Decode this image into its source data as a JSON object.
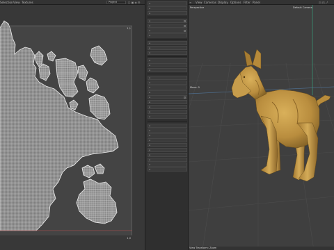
{
  "menubar": {
    "uv_menus": [
      "Selection",
      "View",
      "Textures"
    ],
    "uv_dropdown": "Project",
    "vp_menus": [
      "View",
      "Cameras",
      "Display",
      "Options",
      "Filter",
      "Panel"
    ]
  },
  "uv_editor": {
    "corner_tl": "1,1",
    "corner_br": "1,0"
  },
  "tools": [
    "",
    "",
    "",
    "",
    "",
    "",
    "",
    "",
    "",
    "",
    "",
    "",
    "",
    "",
    "",
    "",
    "",
    "",
    "",
    "",
    "",
    "",
    "",
    "",
    "",
    "",
    "",
    "",
    "",
    "",
    "",
    "",
    "",
    "",
    ""
  ],
  "viewport": {
    "view_name": "Perspective",
    "camera_name": "Default Camera",
    "axis_label": "Move: 0",
    "status_text": "View Transform: Zoom",
    "model": "bull-terrier-dog-model",
    "colors": {
      "background": "#3f3f3f",
      "grid": "#4a4a4a",
      "model": "#c49a45",
      "axis_y": "#3aa07a"
    }
  },
  "icons": {
    "menu": "menu-icon",
    "settings": "gear-icon"
  }
}
